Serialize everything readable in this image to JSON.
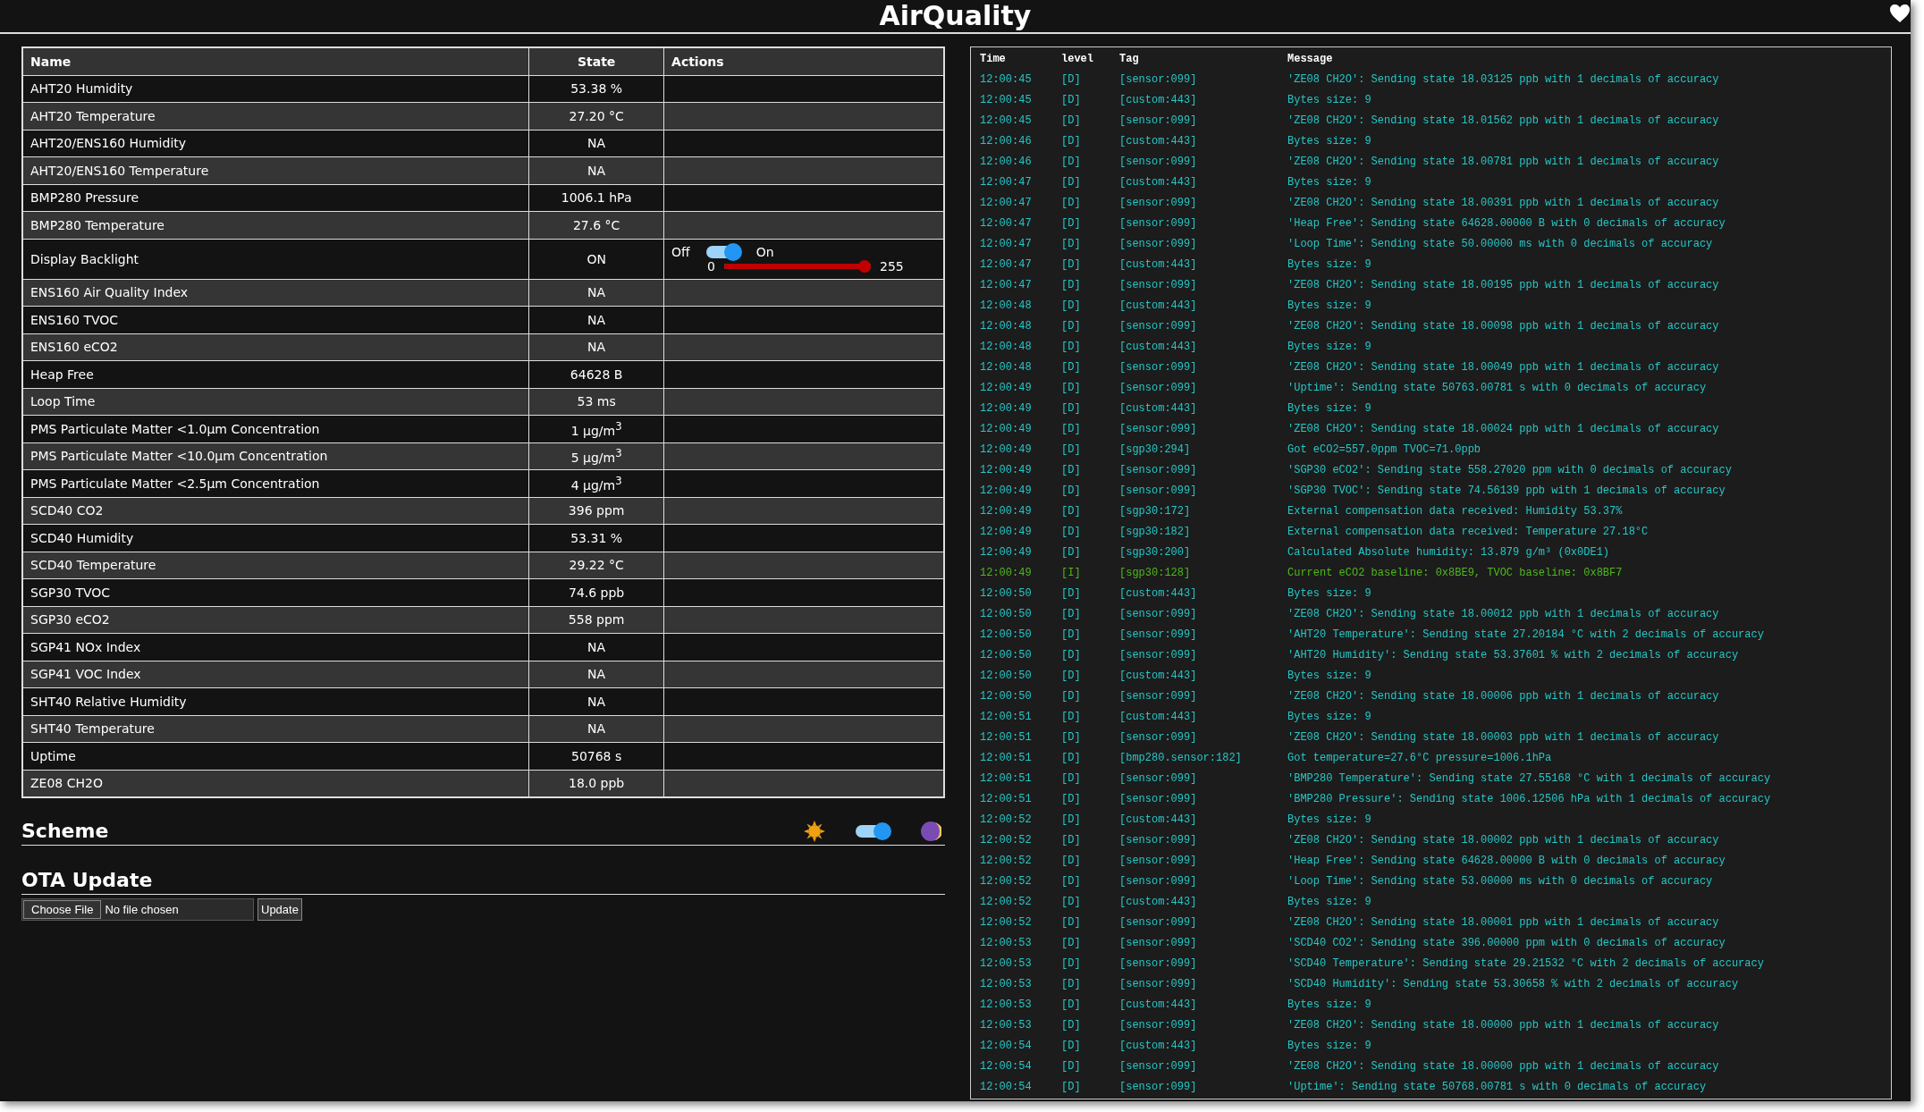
{
  "title": "AirQuality",
  "table": {
    "columns": [
      "Name",
      "State",
      "Actions"
    ],
    "rows": [
      {
        "name": "AHT20 Humidity",
        "state": "53.38 %"
      },
      {
        "name": "AHT20 Temperature",
        "state": "27.20 °C"
      },
      {
        "name": "AHT20/ENS160 Humidity",
        "state": "NA"
      },
      {
        "name": "AHT20/ENS160 Temperature",
        "state": "NA"
      },
      {
        "name": "BMP280 Pressure",
        "state": "1006.1 hPa"
      },
      {
        "name": "BMP280 Temperature",
        "state": "27.6 °C"
      },
      {
        "name": "Display Backlight",
        "state": "ON",
        "actions": {
          "off_label": "Off",
          "on_label": "On",
          "on": true,
          "min": "0",
          "max": "255",
          "level": 1
        }
      },
      {
        "name": "ENS160 Air Quality Index",
        "state": "NA"
      },
      {
        "name": "ENS160 TVOC",
        "state": "NA"
      },
      {
        "name": "ENS160 eCO2",
        "state": "NA"
      },
      {
        "name": "Heap Free",
        "state": "64628 B"
      },
      {
        "name": "Loop Time",
        "state": "53 ms"
      },
      {
        "name": "PMS Particulate Matter <1.0µm Concentration",
        "state": "1 µg/m$^{3}$"
      },
      {
        "name": "PMS Particulate Matter <10.0µm Concentration",
        "state": "5 µg/m$^{3}$"
      },
      {
        "name": "PMS Particulate Matter <2.5µm Concentration",
        "state": "4 µg/m$^{3}$"
      },
      {
        "name": "SCD40 CO2",
        "state": "396 ppm"
      },
      {
        "name": "SCD40 Humidity",
        "state": "53.31 %"
      },
      {
        "name": "SCD40 Temperature",
        "state": "29.22 °C"
      },
      {
        "name": "SGP30 TVOC",
        "state": "74.6 ppb"
      },
      {
        "name": "SGP30 eCO2",
        "state": "558 ppm"
      },
      {
        "name": "SGP41 NOx Index",
        "state": "NA"
      },
      {
        "name": "SGP41 VOC Index",
        "state": "NA"
      },
      {
        "name": "SHT40 Relative Humidity",
        "state": "NA"
      },
      {
        "name": "SHT40 Temperature",
        "state": "NA"
      },
      {
        "name": "Uptime",
        "state": "50768 s"
      },
      {
        "name": "ZE08 CH2O",
        "state": "18.0 ppb"
      }
    ]
  },
  "scheme": {
    "title": "Scheme",
    "dark": true
  },
  "ota": {
    "title": "OTA Update",
    "choose_button": "Choose File",
    "file_status": "No file chosen",
    "update_button": "Update"
  },
  "log": {
    "columns": [
      "Time",
      "level",
      "Tag",
      "Message"
    ],
    "rows": [
      {
        "time": "12:00:45",
        "level": "[D]",
        "tag": "[sensor:099]",
        "message": "'ZE08 CH2O': Sending state 18.03125 ppb with 1 decimals of accuracy",
        "color": "#27c7c7"
      },
      {
        "time": "12:00:45",
        "level": "[D]",
        "tag": "[custom:443]",
        "message": "Bytes size: 9",
        "color": "#27c7c7"
      },
      {
        "time": "12:00:45",
        "level": "[D]",
        "tag": "[sensor:099]",
        "message": "'ZE08 CH2O': Sending state 18.01562 ppb with 1 decimals of accuracy",
        "color": "#27c7c7"
      },
      {
        "time": "12:00:46",
        "level": "[D]",
        "tag": "[custom:443]",
        "message": "Bytes size: 9",
        "color": "#27c7c7"
      },
      {
        "time": "12:00:46",
        "level": "[D]",
        "tag": "[sensor:099]",
        "message": "'ZE08 CH2O': Sending state 18.00781 ppb with 1 decimals of accuracy",
        "color": "#27c7c7"
      },
      {
        "time": "12:00:47",
        "level": "[D]",
        "tag": "[custom:443]",
        "message": "Bytes size: 9",
        "color": "#27c7c7"
      },
      {
        "time": "12:00:47",
        "level": "[D]",
        "tag": "[sensor:099]",
        "message": "'ZE08 CH2O': Sending state 18.00391 ppb with 1 decimals of accuracy",
        "color": "#27c7c7"
      },
      {
        "time": "12:00:47",
        "level": "[D]",
        "tag": "[sensor:099]",
        "message": "'Heap Free': Sending state 64628.00000 B with 0 decimals of accuracy",
        "color": "#27c7c7"
      },
      {
        "time": "12:00:47",
        "level": "[D]",
        "tag": "[sensor:099]",
        "message": "'Loop Time': Sending state 50.00000 ms with 0 decimals of accuracy",
        "color": "#27c7c7"
      },
      {
        "time": "12:00:47",
        "level": "[D]",
        "tag": "[custom:443]",
        "message": "Bytes size: 9",
        "color": "#27c7c7"
      },
      {
        "time": "12:00:47",
        "level": "[D]",
        "tag": "[sensor:099]",
        "message": "'ZE08 CH2O': Sending state 18.00195 ppb with 1 decimals of accuracy",
        "color": "#27c7c7"
      },
      {
        "time": "12:00:48",
        "level": "[D]",
        "tag": "[custom:443]",
        "message": "Bytes size: 9",
        "color": "#27c7c7"
      },
      {
        "time": "12:00:48",
        "level": "[D]",
        "tag": "[sensor:099]",
        "message": "'ZE08 CH2O': Sending state 18.00098 ppb with 1 decimals of accuracy",
        "color": "#27c7c7"
      },
      {
        "time": "12:00:48",
        "level": "[D]",
        "tag": "[custom:443]",
        "message": "Bytes size: 9",
        "color": "#27c7c7"
      },
      {
        "time": "12:00:48",
        "level": "[D]",
        "tag": "[sensor:099]",
        "message": "'ZE08 CH2O': Sending state 18.00049 ppb with 1 decimals of accuracy",
        "color": "#27c7c7"
      },
      {
        "time": "12:00:49",
        "level": "[D]",
        "tag": "[sensor:099]",
        "message": "'Uptime': Sending state 50763.00781 s with 0 decimals of accuracy",
        "color": "#27c7c7"
      },
      {
        "time": "12:00:49",
        "level": "[D]",
        "tag": "[custom:443]",
        "message": "Bytes size: 9",
        "color": "#27c7c7"
      },
      {
        "time": "12:00:49",
        "level": "[D]",
        "tag": "[sensor:099]",
        "message": "'ZE08 CH2O': Sending state 18.00024 ppb with 1 decimals of accuracy",
        "color": "#27c7c7"
      },
      {
        "time": "12:00:49",
        "level": "[D]",
        "tag": "[sgp30:294]",
        "message": "Got eCO2=557.0ppm TVOC=71.0ppb",
        "color": "#27c7c7"
      },
      {
        "time": "12:00:49",
        "level": "[D]",
        "tag": "[sensor:099]",
        "message": "'SGP30 eCO2': Sending state 558.27020 ppm with 0 decimals of accuracy",
        "color": "#27c7c7"
      },
      {
        "time": "12:00:49",
        "level": "[D]",
        "tag": "[sensor:099]",
        "message": "'SGP30 TVOC': Sending state 74.56139 ppb with 1 decimals of accuracy",
        "color": "#27c7c7"
      },
      {
        "time": "12:00:49",
        "level": "[D]",
        "tag": "[sgp30:172]",
        "message": "External compensation data received: Humidity 53.37%",
        "color": "#27c7c7"
      },
      {
        "time": "12:00:49",
        "level": "[D]",
        "tag": "[sgp30:182]",
        "message": "External compensation data received: Temperature 27.18°C",
        "color": "#27c7c7"
      },
      {
        "time": "12:00:49",
        "level": "[D]",
        "tag": "[sgp30:200]",
        "message": "Calculated Absolute humidity: 13.879 g/m³ (0x0DE1)",
        "color": "#27c7c7"
      },
      {
        "time": "12:00:49",
        "level": "[I]",
        "tag": "[sgp30:128]",
        "message": "Current eCO2 baseline: 0x8BE9, TVOC baseline: 0x8BF7",
        "color": "#4fb81d"
      },
      {
        "time": "12:00:50",
        "level": "[D]",
        "tag": "[custom:443]",
        "message": "Bytes size: 9",
        "color": "#27c7c7"
      },
      {
        "time": "12:00:50",
        "level": "[D]",
        "tag": "[sensor:099]",
        "message": "'ZE08 CH2O': Sending state 18.00012 ppb with 1 decimals of accuracy",
        "color": "#27c7c7"
      },
      {
        "time": "12:00:50",
        "level": "[D]",
        "tag": "[sensor:099]",
        "message": "'AHT20 Temperature': Sending state 27.20184 °C with 2 decimals of accuracy",
        "color": "#27c7c7"
      },
      {
        "time": "12:00:50",
        "level": "[D]",
        "tag": "[sensor:099]",
        "message": "'AHT20 Humidity': Sending state 53.37601 % with 2 decimals of accuracy",
        "color": "#27c7c7"
      },
      {
        "time": "12:00:50",
        "level": "[D]",
        "tag": "[custom:443]",
        "message": "Bytes size: 9",
        "color": "#27c7c7"
      },
      {
        "time": "12:00:50",
        "level": "[D]",
        "tag": "[sensor:099]",
        "message": "'ZE08 CH2O': Sending state 18.00006 ppb with 1 decimals of accuracy",
        "color": "#27c7c7"
      },
      {
        "time": "12:00:51",
        "level": "[D]",
        "tag": "[custom:443]",
        "message": "Bytes size: 9",
        "color": "#27c7c7"
      },
      {
        "time": "12:00:51",
        "level": "[D]",
        "tag": "[sensor:099]",
        "message": "'ZE08 CH2O': Sending state 18.00003 ppb with 1 decimals of accuracy",
        "color": "#27c7c7"
      },
      {
        "time": "12:00:51",
        "level": "[D]",
        "tag": "[bmp280.sensor:182]",
        "message": "Got temperature=27.6°C pressure=1006.1hPa",
        "color": "#27c7c7"
      },
      {
        "time": "12:00:51",
        "level": "[D]",
        "tag": "[sensor:099]",
        "message": "'BMP280 Temperature': Sending state 27.55168 °C with 1 decimals of accuracy",
        "color": "#27c7c7"
      },
      {
        "time": "12:00:51",
        "level": "[D]",
        "tag": "[sensor:099]",
        "message": "'BMP280 Pressure': Sending state 1006.12506 hPa with 1 decimals of accuracy",
        "color": "#27c7c7"
      },
      {
        "time": "12:00:52",
        "level": "[D]",
        "tag": "[custom:443]",
        "message": "Bytes size: 9",
        "color": "#27c7c7"
      },
      {
        "time": "12:00:52",
        "level": "[D]",
        "tag": "[sensor:099]",
        "message": "'ZE08 CH2O': Sending state 18.00002 ppb with 1 decimals of accuracy",
        "color": "#27c7c7"
      },
      {
        "time": "12:00:52",
        "level": "[D]",
        "tag": "[sensor:099]",
        "message": "'Heap Free': Sending state 64628.00000 B with 0 decimals of accuracy",
        "color": "#27c7c7"
      },
      {
        "time": "12:00:52",
        "level": "[D]",
        "tag": "[sensor:099]",
        "message": "'Loop Time': Sending state 53.00000 ms with 0 decimals of accuracy",
        "color": "#27c7c7"
      },
      {
        "time": "12:00:52",
        "level": "[D]",
        "tag": "[custom:443]",
        "message": "Bytes size: 9",
        "color": "#27c7c7"
      },
      {
        "time": "12:00:52",
        "level": "[D]",
        "tag": "[sensor:099]",
        "message": "'ZE08 CH2O': Sending state 18.00001 ppb with 1 decimals of accuracy",
        "color": "#27c7c7"
      },
      {
        "time": "12:00:53",
        "level": "[D]",
        "tag": "[sensor:099]",
        "message": "'SCD40 CO2': Sending state 396.00000 ppm with 0 decimals of accuracy",
        "color": "#27c7c7"
      },
      {
        "time": "12:00:53",
        "level": "[D]",
        "tag": "[sensor:099]",
        "message": "'SCD40 Temperature': Sending state 29.21532 °C with 2 decimals of accuracy",
        "color": "#27c7c7"
      },
      {
        "time": "12:00:53",
        "level": "[D]",
        "tag": "[sensor:099]",
        "message": "'SCD40 Humidity': Sending state 53.30658 % with 2 decimals of accuracy",
        "color": "#27c7c7"
      },
      {
        "time": "12:00:53",
        "level": "[D]",
        "tag": "[custom:443]",
        "message": "Bytes size: 9",
        "color": "#27c7c7"
      },
      {
        "time": "12:00:53",
        "level": "[D]",
        "tag": "[sensor:099]",
        "message": "'ZE08 CH2O': Sending state 18.00000 ppb with 1 decimals of accuracy",
        "color": "#27c7c7"
      },
      {
        "time": "12:00:54",
        "level": "[D]",
        "tag": "[custom:443]",
        "message": "Bytes size: 9",
        "color": "#27c7c7"
      },
      {
        "time": "12:00:54",
        "level": "[D]",
        "tag": "[sensor:099]",
        "message": "'ZE08 CH2O': Sending state 18.00000 ppb with 1 decimals of accuracy",
        "color": "#27c7c7"
      },
      {
        "time": "12:00:54",
        "level": "[D]",
        "tag": "[sensor:099]",
        "message": "'Uptime': Sending state 50768.00781 s with 0 decimals of accuracy",
        "color": "#27c7c7"
      }
    ]
  }
}
